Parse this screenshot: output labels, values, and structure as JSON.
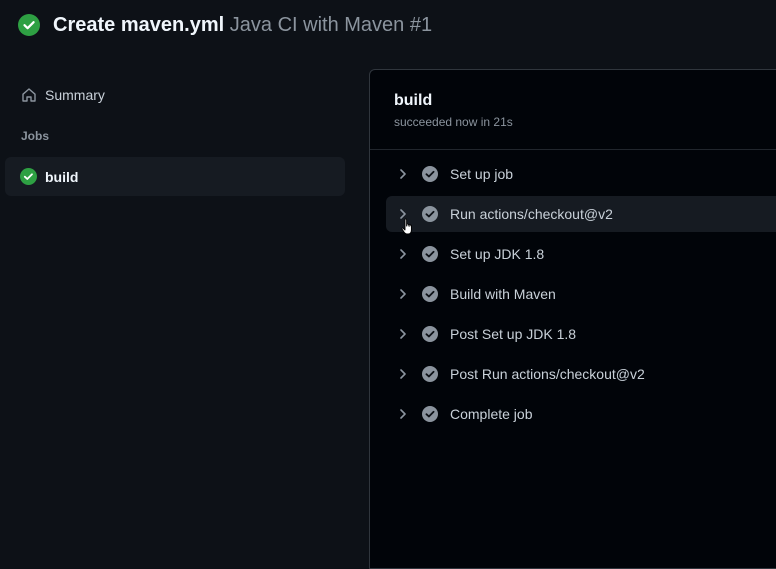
{
  "header": {
    "commit_title": "Create maven.yml",
    "workflow_run": "Java CI with Maven #1",
    "status_icon": "check-circle-fill-icon",
    "status_color": "#2ea043"
  },
  "sidebar": {
    "summary_label": "Summary",
    "summary_icon": "home-icon",
    "jobs_heading": "Jobs",
    "jobs": [
      {
        "label": "build",
        "status": "success",
        "icon": "check-circle-fill-icon"
      }
    ]
  },
  "job": {
    "title": "build",
    "status_text": "succeeded now in 21s",
    "steps": [
      {
        "label": "Set up job",
        "status": "success"
      },
      {
        "label": "Run actions/checkout@v2",
        "status": "success",
        "hovered": true
      },
      {
        "label": "Set up JDK 1.8",
        "status": "success"
      },
      {
        "label": "Build with Maven",
        "status": "success"
      },
      {
        "label": "Post Set up JDK 1.8",
        "status": "success"
      },
      {
        "label": "Post Run actions/checkout@v2",
        "status": "success"
      },
      {
        "label": "Complete job",
        "status": "success"
      }
    ]
  },
  "colors": {
    "background": "#0d1117",
    "panel_background": "#010409",
    "success": "#2ea043",
    "step_check": "#8b949e"
  }
}
